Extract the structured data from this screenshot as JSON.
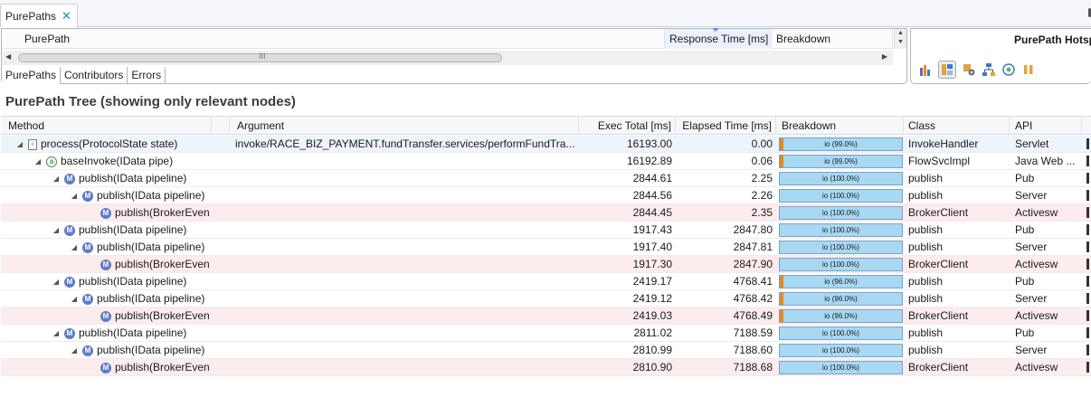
{
  "tab": {
    "label": "PurePaths",
    "close_glyph": "✕"
  },
  "purepaths_grid": {
    "columns": [
      "PurePath",
      "Response Time [ms]",
      "Breakdown"
    ],
    "scroll_grip": "III",
    "subtabs": [
      "PurePaths",
      "Contributors",
      "Errors"
    ]
  },
  "hotspot": {
    "title": "PurePath Hotsp",
    "icons": [
      "bar-chart-icon",
      "layout-icon",
      "settings-icon",
      "tree-structure-icon",
      "network-icon",
      "pause-icon"
    ]
  },
  "tree": {
    "title": "PurePath Tree (showing only relevant nodes)",
    "columns": [
      "Method",
      "Argument",
      "Exec Total [ms]",
      "Elapsed Time [ms]",
      "Breakdown",
      "Class",
      "API"
    ],
    "rows": [
      {
        "level": 0,
        "icon": "doc",
        "method": "process(ProtocolState state)",
        "argument": "invoke/RACE_BIZ_PAYMENT.fundTransfer.services/performFundTra...",
        "exec": "16193.00",
        "elapsed": "0.00",
        "breakdown": "io (99.0%)",
        "io_pct": 99.0,
        "class": "InvokeHandler",
        "api": "Servlet",
        "highlight": false,
        "selected": true
      },
      {
        "level": 1,
        "icon": "base",
        "method": "baseInvoke(IData pipe)",
        "argument": "",
        "exec": "16192.89",
        "elapsed": "0.06",
        "breakdown": "io (99.0%)",
        "io_pct": 99.0,
        "class": "FlowSvcImpl",
        "api": "Java Web ...",
        "highlight": false,
        "selected": false
      },
      {
        "level": 2,
        "icon": "m",
        "method": "publish(IData pipeline)",
        "argument": "",
        "exec": "2844.61",
        "elapsed": "2.25",
        "breakdown": "io (100.0%)",
        "io_pct": 100.0,
        "class": "publish",
        "api": "Pub",
        "highlight": false,
        "selected": false
      },
      {
        "level": 3,
        "icon": "m",
        "method": "publish(IData pipeline)",
        "argument": "",
        "exec": "2844.56",
        "elapsed": "2.26",
        "breakdown": "io (100.0%)",
        "io_pct": 100.0,
        "class": "publish",
        "api": "Server",
        "highlight": false,
        "selected": false
      },
      {
        "level": 4,
        "icon": "m",
        "method": "publish(BrokerEven",
        "argument": "",
        "exec": "2844.45",
        "elapsed": "2.35",
        "breakdown": "io (100.0%)",
        "io_pct": 100.0,
        "class": "BrokerClient",
        "api": "Activesw",
        "highlight": true,
        "selected": false
      },
      {
        "level": 2,
        "icon": "m",
        "method": "publish(IData pipeline)",
        "argument": "",
        "exec": "1917.43",
        "elapsed": "2847.80",
        "breakdown": "io (100.0%)",
        "io_pct": 100.0,
        "class": "publish",
        "api": "Pub",
        "highlight": false,
        "selected": false
      },
      {
        "level": 3,
        "icon": "m",
        "method": "publish(IData pipeline)",
        "argument": "",
        "exec": "1917.40",
        "elapsed": "2847.81",
        "breakdown": "io (100.0%)",
        "io_pct": 100.0,
        "class": "publish",
        "api": "Server",
        "highlight": false,
        "selected": false
      },
      {
        "level": 4,
        "icon": "m",
        "method": "publish(BrokerEven",
        "argument": "",
        "exec": "1917.30",
        "elapsed": "2847.90",
        "breakdown": "io (100.0%)",
        "io_pct": 100.0,
        "class": "BrokerClient",
        "api": "Activesw",
        "highlight": true,
        "selected": false
      },
      {
        "level": 2,
        "icon": "m",
        "method": "publish(IData pipeline)",
        "argument": "",
        "exec": "2419.17",
        "elapsed": "4768.41",
        "breakdown": "io (96.0%)",
        "io_pct": 96.0,
        "class": "publish",
        "api": "Pub",
        "highlight": false,
        "selected": false
      },
      {
        "level": 3,
        "icon": "m",
        "method": "publish(IData pipeline)",
        "argument": "",
        "exec": "2419.12",
        "elapsed": "4768.42",
        "breakdown": "io (96.0%)",
        "io_pct": 96.0,
        "class": "publish",
        "api": "Server",
        "highlight": false,
        "selected": false
      },
      {
        "level": 4,
        "icon": "m",
        "method": "publish(BrokerEven",
        "argument": "",
        "exec": "2419.03",
        "elapsed": "4768.49",
        "breakdown": "io (96.0%)",
        "io_pct": 96.0,
        "class": "BrokerClient",
        "api": "Activesw",
        "highlight": true,
        "selected": false
      },
      {
        "level": 2,
        "icon": "m",
        "method": "publish(IData pipeline)",
        "argument": "",
        "exec": "2811.02",
        "elapsed": "7188.59",
        "breakdown": "io (100.0%)",
        "io_pct": 100.0,
        "class": "publish",
        "api": "Pub",
        "highlight": false,
        "selected": false
      },
      {
        "level": 3,
        "icon": "m",
        "method": "publish(IData pipeline)",
        "argument": "",
        "exec": "2810.99",
        "elapsed": "7188.60",
        "breakdown": "io (100.0%)",
        "io_pct": 100.0,
        "class": "publish",
        "api": "Server",
        "highlight": false,
        "selected": false
      },
      {
        "level": 4,
        "icon": "m",
        "method": "publish(BrokerEven",
        "argument": "",
        "exec": "2810.90",
        "elapsed": "7188.68",
        "breakdown": "io (100.0%)",
        "io_pct": 100.0,
        "class": "BrokerClient",
        "api": "Activesw",
        "highlight": true,
        "selected": false
      }
    ]
  },
  "colors": {
    "cpu": "#e68a1e",
    "io": "#a8d8f2",
    "highlight_row": "#fdeced",
    "accent": "#1b8ea6"
  }
}
